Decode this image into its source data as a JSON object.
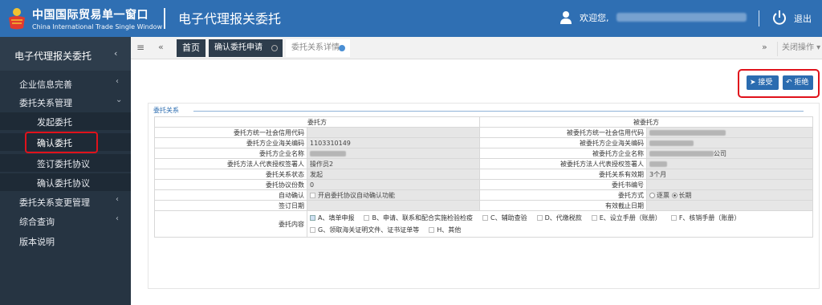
{
  "header": {
    "brand_cn": "中国国际贸易单一窗口",
    "brand_en": "China International Trade Single Window",
    "system_title": "电子代理报关委托",
    "welcome": "欢迎您,",
    "logout": "退出"
  },
  "sidebar": {
    "title": "电子代理报关委托",
    "items": [
      {
        "label": "企业信息完善"
      },
      {
        "label": "委托关系管理"
      },
      {
        "label": "委托关系变更管理"
      },
      {
        "label": "综合查询"
      },
      {
        "label": "版本说明"
      }
    ],
    "subitems": [
      {
        "label": "发起委托"
      },
      {
        "label": "确认委托"
      },
      {
        "label": "签订委托协议"
      },
      {
        "label": "确认委托协议"
      }
    ]
  },
  "tabs": {
    "home": "首页",
    "tab1": "确认委托申请",
    "tab2": "委托关系详情",
    "close_ops": "关闭操作"
  },
  "actions": {
    "accept": "接受",
    "reject": "拒绝"
  },
  "panel": {
    "title": "委托关系",
    "col_client": "委托方",
    "col_agent": "被委托方",
    "rows": {
      "l_credit": "委托方统一社会信用代码",
      "r_credit": "被委托方统一社会信用代码",
      "l_customs": "委托方企业海关编码",
      "l_customs_val": "1103310149",
      "r_customs": "被委托方企业海关编码",
      "l_name": "委托方企业名称",
      "r_name": "被委托方企业名称",
      "r_name_suffix": "公司",
      "l_legal": "委托方法人代表授权签署人",
      "l_legal_val": "操作员2",
      "r_legal": "被委托方法人代表授权签署人",
      "l_status": "委托关系状态",
      "l_status_val": "发起",
      "r_validity": "委托关系有效期",
      "r_validity_val": "3个月",
      "l_copies": "委托协议份数",
      "l_copies_val": "0",
      "r_bookno": "委托书编号",
      "l_auto": "自动确认",
      "l_auto_val": "开启委托协议自动确认功能",
      "r_method": "委托方式",
      "r_method_opt1": "逐票",
      "r_method_opt2": "长期",
      "l_signdate": "签订日期",
      "r_expire": "有效截止日期",
      "content_label": "委托内容"
    },
    "content_options": [
      {
        "label": "A、填单申报",
        "checked": true
      },
      {
        "label": "B、申请、联系和配合实施检验检疫",
        "checked": false
      },
      {
        "label": "C、辅助查验",
        "checked": false
      },
      {
        "label": "D、代缴税款",
        "checked": false
      },
      {
        "label": "E、设立手册（账册）",
        "checked": false
      },
      {
        "label": "F、核销手册（账册）",
        "checked": false
      },
      {
        "label": "G、领取海关证明文件、证书证单等",
        "checked": false
      },
      {
        "label": "H、其他",
        "checked": false
      }
    ]
  },
  "colors": {
    "header_blue": "#2f6fb3",
    "sidebar_dark": "#263442",
    "highlight_red": "#e0121b",
    "button_blue": "#2b6cb0"
  }
}
